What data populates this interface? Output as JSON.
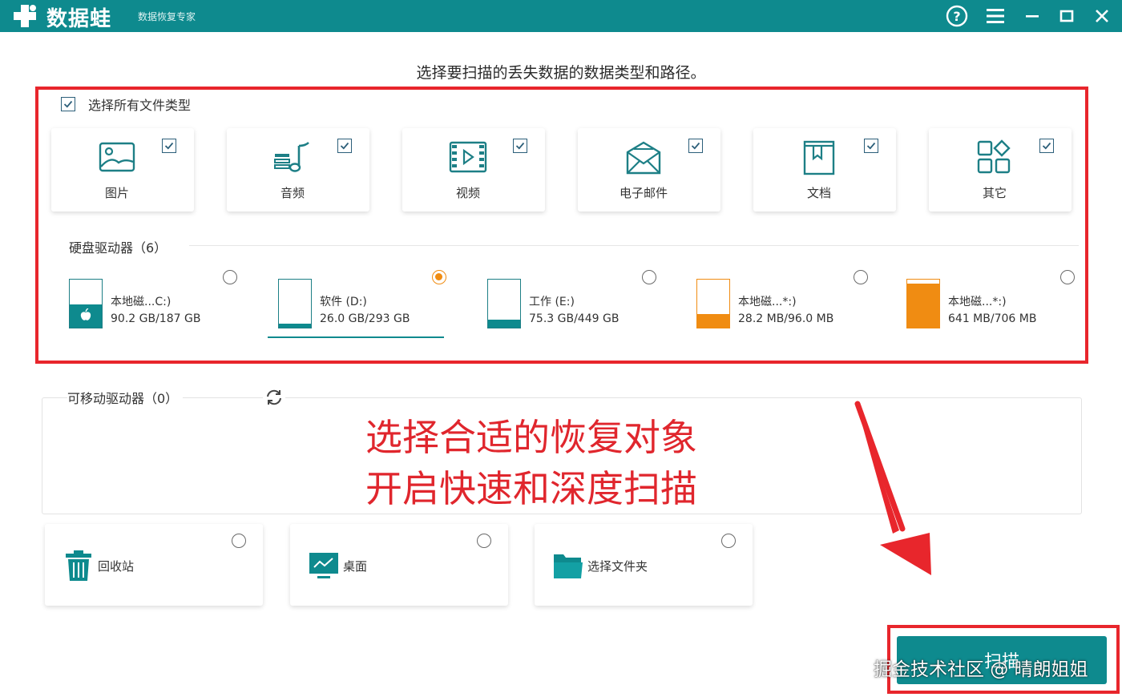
{
  "titlebar": {
    "app_name": "数据蛙",
    "subtitle": "数据恢复专家",
    "colors": {
      "bar": "#0e8a8e"
    },
    "buttons": [
      "help-icon",
      "menu-icon",
      "minimize-icon",
      "maximize-icon",
      "close-icon"
    ]
  },
  "prompt": "选择要扫描的丢失数据的数据类型和路径。",
  "file_types": {
    "select_all_label": "选择所有文件类型",
    "select_all_checked": true,
    "items": [
      {
        "label": "图片",
        "icon": "image-icon",
        "checked": true
      },
      {
        "label": "音频",
        "icon": "audio-icon",
        "checked": true
      },
      {
        "label": "视频",
        "icon": "video-icon",
        "checked": true
      },
      {
        "label": "电子邮件",
        "icon": "email-icon",
        "checked": true
      },
      {
        "label": "文档",
        "icon": "document-icon",
        "checked": true
      },
      {
        "label": "其它",
        "icon": "other-icon",
        "checked": true
      }
    ]
  },
  "hard_drives": {
    "label": "硬盘驱动器（6）",
    "items": [
      {
        "name": "本地磁...C:)",
        "size": "90.2 GB/187 GB",
        "fill": 0.48,
        "color": "#0e8a8e",
        "selected": false
      },
      {
        "name": "软件 (D:)",
        "size": "26.0 GB/293 GB",
        "fill": 0.09,
        "color": "#0e8a8e",
        "selected": true
      },
      {
        "name": "工作 (E:)",
        "size": "75.3 GB/449 GB",
        "fill": 0.17,
        "color": "#0e8a8e",
        "selected": false
      },
      {
        "name": "本地磁...*:)",
        "size": "28.2 MB/96.0 MB",
        "fill": 0.29,
        "color": "#f08c12",
        "selected": false
      },
      {
        "name": "本地磁...*:)",
        "size": "641 MB/706 MB",
        "fill": 0.91,
        "color": "#f08c12",
        "selected": false
      }
    ]
  },
  "removable": {
    "label": "可移动驱动器（0）",
    "refresh_icon": "refresh-icon"
  },
  "annotation": {
    "line1": "选择合适的恢复对象",
    "line2": "开启快速和深度扫描",
    "color": "#e0262d"
  },
  "locations": [
    {
      "label": "回收站",
      "icon": "recycle-bin-icon",
      "selected": false
    },
    {
      "label": "桌面",
      "icon": "desktop-icon",
      "selected": false
    },
    {
      "label": "选择文件夹",
      "icon": "folder-icon",
      "selected": false
    }
  ],
  "scan_button": "扫描",
  "watermark": "掘金技术社区 @ 晴朗姐姐"
}
